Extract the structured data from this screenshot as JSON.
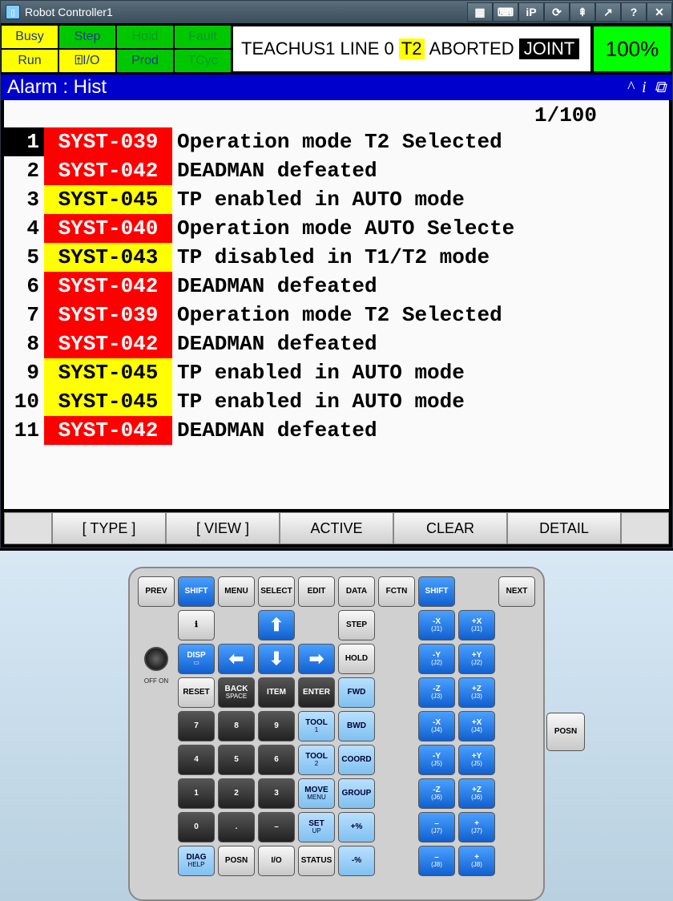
{
  "window": {
    "title": "Robot Controller1"
  },
  "titlebar_buttons": [
    "▦",
    "⌨",
    "iP",
    "⟳",
    "⇞",
    "↗",
    "?",
    "✕"
  ],
  "status_grid": {
    "r1": [
      "Busy",
      "Step",
      "Hold",
      "Fault"
    ],
    "r2": [
      "Run",
      "I/O",
      "Prod",
      "TCyc"
    ]
  },
  "status_line": {
    "prog": "TEACHUS1 LINE 0",
    "mode": "T2",
    "state": "ABORTED",
    "coord": "JOINT"
  },
  "percent": "100%",
  "alarm_header": "Alarm : Hist",
  "counter": "1/100",
  "alarms": [
    {
      "num": "1",
      "code": "SYST-039",
      "sev": "red",
      "msg": "Operation mode T2 Selected",
      "sel": true
    },
    {
      "num": "2",
      "code": "SYST-042",
      "sev": "red",
      "msg": "DEADMAN defeated"
    },
    {
      "num": "3",
      "code": "SYST-045",
      "sev": "yel",
      "msg": "TP enabled in AUTO mode"
    },
    {
      "num": "4",
      "code": "SYST-040",
      "sev": "red",
      "msg": "Operation mode AUTO Selecte"
    },
    {
      "num": "5",
      "code": "SYST-043",
      "sev": "yel",
      "msg": "TP disabled in T1/T2 mode"
    },
    {
      "num": "6",
      "code": "SYST-042",
      "sev": "red",
      "msg": "DEADMAN defeated"
    },
    {
      "num": "7",
      "code": "SYST-039",
      "sev": "red",
      "msg": "Operation mode T2 Selected"
    },
    {
      "num": "8",
      "code": "SYST-042",
      "sev": "red",
      "msg": "DEADMAN defeated"
    },
    {
      "num": "9",
      "code": "SYST-045",
      "sev": "yel",
      "msg": "TP enabled in AUTO mode"
    },
    {
      "num": "10",
      "code": "SYST-045",
      "sev": "yel",
      "msg": "TP enabled in AUTO mode"
    },
    {
      "num": "11",
      "code": "SYST-042",
      "sev": "red",
      "msg": "DEADMAN defeated"
    }
  ],
  "softkeys": [
    "[ TYPE ]",
    "[ VIEW ]",
    "ACTIVE",
    "CLEAR",
    "DETAIL"
  ],
  "pendant": {
    "off_on": "OFF  ON",
    "posn_side": "POSN",
    "grid": [
      [
        {
          "t": "PREV"
        },
        {
          "t": "SHIFT",
          "c": "blue"
        },
        {
          "t": "MENU"
        },
        {
          "t": "SELECT"
        },
        {
          "t": "EDIT"
        },
        {
          "t": "DATA"
        },
        {
          "t": "FCTN"
        },
        {
          "t": "SHIFT",
          "c": "blue"
        },
        null,
        {
          "t": "NEXT"
        }
      ],
      [
        null,
        {
          "t": "ℹ",
          "c": "pbtn"
        },
        null,
        {
          "t": "⬆",
          "c": "blue big-arrow"
        },
        null,
        {
          "t": "STEP"
        },
        null,
        {
          "t": "-X",
          "s": "(J1)",
          "c": "blue"
        },
        {
          "t": "+X",
          "s": "(J1)",
          "c": "blue"
        },
        null
      ],
      [
        null,
        {
          "t": "DISP",
          "s": "▭",
          "c": "blue"
        },
        {
          "t": "⬅",
          "c": "blue big-arrow"
        },
        {
          "t": "⬇",
          "c": "blue big-arrow"
        },
        {
          "t": "➡",
          "c": "blue big-arrow"
        },
        {
          "t": "HOLD"
        },
        null,
        {
          "t": "-Y",
          "s": "(J2)",
          "c": "blue"
        },
        {
          "t": "+Y",
          "s": "(J2)",
          "c": "blue"
        },
        null
      ],
      [
        null,
        {
          "t": "RESET"
        },
        {
          "t": "BACK",
          "s": "SPACE",
          "c": "dark"
        },
        {
          "t": "ITEM",
          "c": "dark"
        },
        {
          "t": "ENTER",
          "c": "dark"
        },
        {
          "t": "FWD",
          "c": "lblue"
        },
        null,
        {
          "t": "-Z",
          "s": "(J3)",
          "c": "blue"
        },
        {
          "t": "+Z",
          "s": "(J3)",
          "c": "blue"
        },
        null
      ],
      [
        null,
        {
          "t": "7",
          "c": "dark"
        },
        {
          "t": "8",
          "c": "dark"
        },
        {
          "t": "9",
          "c": "dark"
        },
        {
          "t": "TOOL",
          "s": "1",
          "c": "lblue"
        },
        {
          "t": "BWD",
          "c": "lblue"
        },
        null,
        {
          "t": "-X",
          "s": "(J4)",
          "c": "blue"
        },
        {
          "t": "+X",
          "s": "(J4)",
          "c": "blue"
        },
        null
      ],
      [
        null,
        {
          "t": "4",
          "c": "dark"
        },
        {
          "t": "5",
          "c": "dark"
        },
        {
          "t": "6",
          "c": "dark"
        },
        {
          "t": "TOOL",
          "s": "2",
          "c": "lblue"
        },
        {
          "t": "COORD",
          "c": "lblue"
        },
        null,
        {
          "t": "-Y",
          "s": "(J5)",
          "c": "blue"
        },
        {
          "t": "+Y",
          "s": "(J5)",
          "c": "blue"
        },
        null
      ],
      [
        null,
        {
          "t": "1",
          "c": "dark"
        },
        {
          "t": "2",
          "c": "dark"
        },
        {
          "t": "3",
          "c": "dark"
        },
        {
          "t": "MOVE",
          "s": "MENU",
          "c": "lblue"
        },
        {
          "t": "GROUP",
          "c": "lblue"
        },
        null,
        {
          "t": "-Z",
          "s": "(J6)",
          "c": "blue"
        },
        {
          "t": "+Z",
          "s": "(J6)",
          "c": "blue"
        },
        null
      ],
      [
        null,
        {
          "t": "0",
          "c": "dark"
        },
        {
          "t": ".",
          "c": "dark"
        },
        {
          "t": "–",
          "c": "dark"
        },
        {
          "t": "SET",
          "s": "UP",
          "c": "lblue"
        },
        {
          "t": "+%",
          "c": "lblue"
        },
        null,
        {
          "t": "–",
          "s": "(J7)",
          "c": "blue"
        },
        {
          "t": "+",
          "s": "(J7)",
          "c": "blue"
        },
        null
      ],
      [
        null,
        {
          "t": "DIAG",
          "s": "HELP",
          "c": "lblue"
        },
        {
          "t": "POSN"
        },
        {
          "t": "I/O"
        },
        {
          "t": "STATUS"
        },
        {
          "t": "-%",
          "c": "lblue"
        },
        null,
        {
          "t": "–",
          "s": "(J8)",
          "c": "blue"
        },
        {
          "t": "+",
          "s": "(J8)",
          "c": "blue"
        },
        null
      ]
    ]
  }
}
